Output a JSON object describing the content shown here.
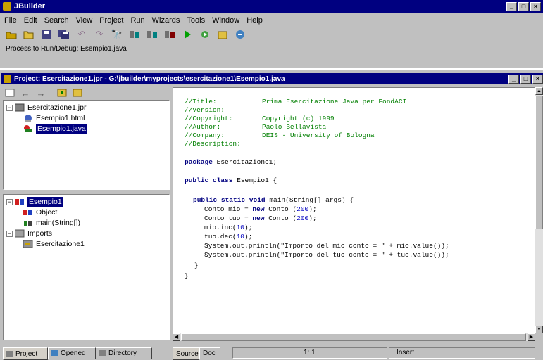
{
  "app": {
    "title": "JBuilder",
    "window_buttons": [
      "_",
      "□",
      "×"
    ]
  },
  "menu": [
    "File",
    "Edit",
    "Search",
    "View",
    "Project",
    "Run",
    "Wizards",
    "Tools",
    "Window",
    "Help"
  ],
  "toolbar": {
    "icons": [
      "open-project-icon",
      "open-file-icon",
      "save-icon",
      "save-all-icon",
      "undo-icon",
      "redo-icon",
      "find-icon",
      "make-icon",
      "rebuild-icon",
      "build-icon",
      "run-icon",
      "debug-icon",
      "wizard-icon",
      "help-icon"
    ]
  },
  "status_top": "Process to Run/Debug: Esempio1.java",
  "project_window": {
    "title": "Project: Esercitazione1.jpr - G:\\jbuilder\\myprojects\\esercitazione1\\Esempio1.java"
  },
  "project_tree": {
    "root": "Esercitazione1.jpr",
    "children": [
      "Esempio1.html",
      "Esempio1.java"
    ]
  },
  "structure_tree": {
    "class": "Esempio1",
    "members": [
      "Object",
      "main(String[])"
    ],
    "imports_label": "Imports",
    "imports": [
      "Esercitazione1"
    ]
  },
  "code": {
    "comments": [
      [
        "//Title:",
        "Prima Esercitazione Java per FondACI"
      ],
      [
        "//Version:",
        ""
      ],
      [
        "//Copyright:",
        "Copyright (c) 1999"
      ],
      [
        "//Author:",
        "Paolo Bellavista"
      ],
      [
        "//Company:",
        "DEIS - University of Bologna"
      ],
      [
        "//Description:",
        ""
      ]
    ],
    "package_kw": "package",
    "package_name": "Esercitazione1;",
    "class_kw": "public class",
    "class_name": "Esempio1 {",
    "main_kw": "public static void",
    "main_sig": "main(String[] args) {",
    "line1_a": "Conto mio = ",
    "line1_kw": "new",
    "line1_b": " Conto (",
    "line1_num": "200",
    "line1_c": ");",
    "line2_a": "Conto tuo = ",
    "line2_kw": "new",
    "line2_b": " Conto (",
    "line2_num": "200",
    "line2_c": ");",
    "line3_a": "mio.inc(",
    "line3_num": "10",
    "line3_c": ");",
    "line4_a": "tuo.dec(",
    "line4_num": "10",
    "line4_c": ");",
    "line5": "System.out.println(\"Importo del mio conto = \" + mio.value());",
    "line6": "System.out.println(\"Importo del tuo conto = \" + tuo.value());",
    "close_inner": "}",
    "close_outer": "}"
  },
  "bottom_tabs_left": [
    "Project",
    "Opened",
    "Directory"
  ],
  "bottom_tabs_editor": [
    "Source",
    "Doc"
  ],
  "status_bar": {
    "position": "1: 1",
    "mode": "Insert"
  },
  "colors": {
    "titlebar": "#000080",
    "chrome": "#c0c0c0",
    "comment": "#007f00",
    "keyword": "#000080"
  }
}
